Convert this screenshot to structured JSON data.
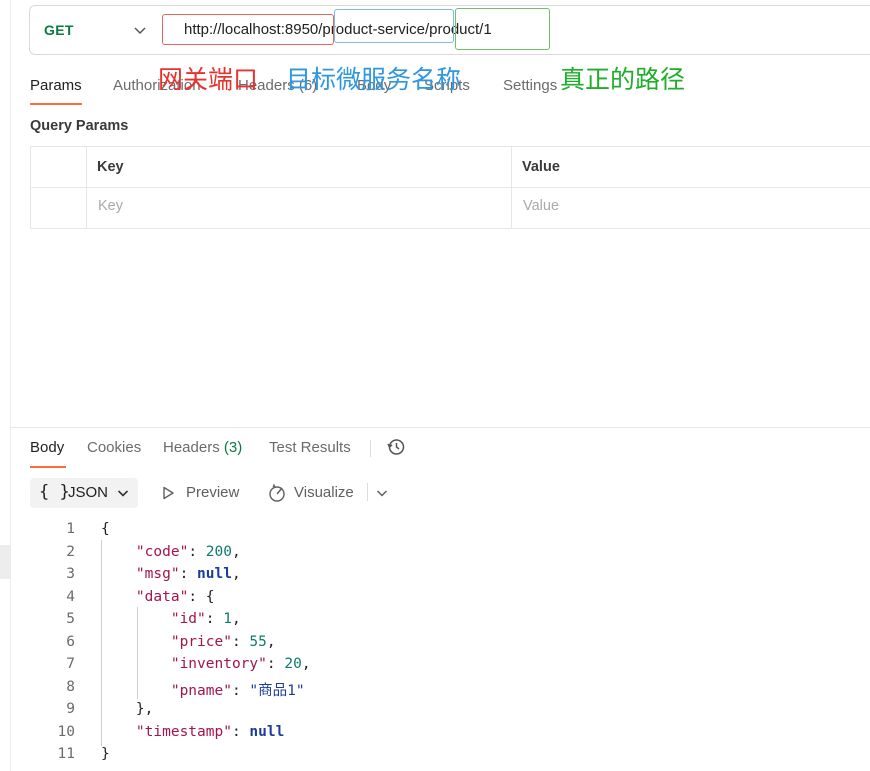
{
  "request": {
    "method": "GET",
    "url": "http://localhost:8950/product-service/product/1"
  },
  "annotations": {
    "gateway_port": "网关端口",
    "target_service": "目标微服务名称",
    "real_path": "真正的路径",
    "colors": {
      "gateway_port": "#e8322e",
      "target_service": "#2f97e0",
      "real_path": "#1fae2c"
    }
  },
  "request_tabs": [
    "Params",
    "Authorization",
    "Headers (6)",
    "Body",
    "Scripts",
    "Settings"
  ],
  "query_params": {
    "title": "Query Params",
    "columns": [
      "Key",
      "Value"
    ],
    "placeholders": {
      "key": "Key",
      "value": "Value"
    }
  },
  "response": {
    "tabs": {
      "body": "Body",
      "cookies": "Cookies",
      "headers": "Headers",
      "headers_count": "(3)",
      "test_results": "Test Results"
    },
    "toolbar": {
      "format_braces": "{ }",
      "format": "JSON",
      "preview": "Preview",
      "visualize": "Visualize"
    },
    "line_numbers": [
      "1",
      "2",
      "3",
      "4",
      "5",
      "6",
      "7",
      "8",
      "9",
      "10",
      "11"
    ],
    "body_json": {
      "code": 200,
      "msg": "null",
      "data": {
        "id": 1,
        "price": 55,
        "inventory": 20,
        "pname": "商品1"
      },
      "timestamp": "null"
    }
  },
  "icons": [
    "chevron-down-icon",
    "history-icon",
    "preview-play-icon",
    "visualize-icon"
  ],
  "accent_color": "#ff6c37"
}
